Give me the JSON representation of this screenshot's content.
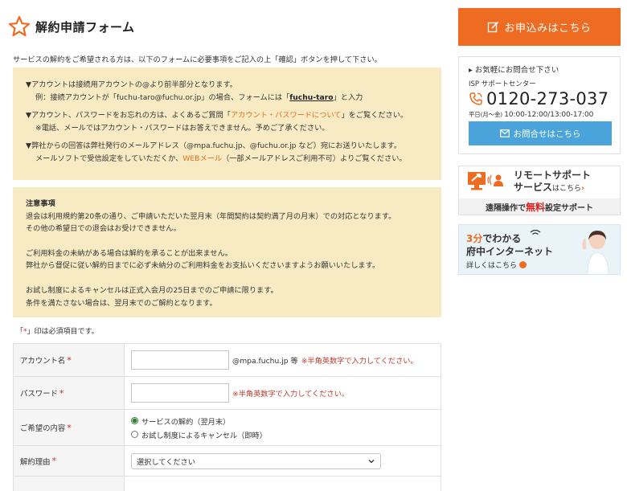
{
  "page": {
    "title": "解約申請フォーム",
    "intro": "サービスの解約をご希望される方は、以下のフォームに必要事項をご記入の上「確認」ボタンを押して下さい。"
  },
  "notice1": {
    "p1_line1": "▼アカウントは接続用アカウントの@より前半部分となります。",
    "p1_line2_a": "例：接続アカウントが「fuchu-taro@fuchu.or.jp」の場合、フォームには「",
    "p1_line2_b": "fuchu-taro",
    "p1_line2_c": "」と入力",
    "p2_line1_a": "▼アカウント、パスワードをお忘れの方は、よくあるご質問「",
    "p2_line1_b": "アカウント・パスワードについて",
    "p2_line1_c": "」をご覧ください。",
    "p2_line2": "※電話、メールではアカウント・パスワードはお答えできません。予めご了承ください。",
    "p3_line1": "▼弊社からの回答は弊社発行のメールアドレス（@mpa.fuchu.jp、@fuchu.or.jp など）宛にお送りいたします。",
    "p3_line2_a": "メールソフトで受信設定をしていただくか、",
    "p3_line2_b": "WEBメール",
    "p3_line2_c": "（一部メールアドレスご利用不可）よりご覧ください。"
  },
  "notice2": {
    "heading": "注意事項",
    "l1": "退会は利用規約第20条の通り、ご申請いただいた翌月末（年間契約は契約満了月の月末）での対応となります。",
    "l2": "その他の希望日での退会はお受けできません。",
    "l3": "ご利用料金の未納がある場合は解約を承ることが出来ません。",
    "l4": "弊社から督促に従い解約日までに必ず未納分のご利用料金をお支払いくださいますようお願いいたします。",
    "l5": "お試し制度によるキャンセルは正式入会月の25日までのご申請に限ります。",
    "l6": "条件を満たさない場合は、翌月末でのご解約となります。"
  },
  "form": {
    "required_note_a": "「",
    "required_mark": "*",
    "required_note_b": "」印は必須項目です。",
    "account_label": "アカウント名",
    "account_suffix": "@mpa.fuchu.jp 等",
    "account_hint": "※半角英数字で入力してください。",
    "password_label": "パスワード",
    "password_hint": "※半角英数字で入力してください。",
    "request_label": "ご希望の内容",
    "request_options": [
      "サービスの解約（翌月末）",
      "お試し制度によるキャンセル（即時）"
    ],
    "reason_label": "解約理由",
    "reason_selected": "選択してください"
  },
  "sidebar": {
    "apply_label": "お申込みはこちら",
    "contact_heading": "▸ お気軽にお問合せ下さい",
    "isp_label": "ISP サポートセンター",
    "phone": "0120-273-037",
    "hours_a": "平日(月〜金)",
    "hours_b": "10:00-12:00/13:00-17:00",
    "contact_button": "お問合せはこちら",
    "remote_title1": "リモートサポート",
    "remote_title2_a": "サービス",
    "remote_title2_b": "はこちら",
    "remote_arrow": "›",
    "remote_sub_a": "遠隔操作で",
    "remote_sub_b": "無料",
    "remote_sub_c": "設定サポート",
    "internet_title1_a": "3分",
    "internet_title1_b": "でわかる",
    "internet_title2": "府中インターネット",
    "internet_link": "詳しくはこちら"
  },
  "colors": {
    "accent_orange": "#ee6c22",
    "notice_bg": "#f8ebc4",
    "contact_blue": "#4aa4db",
    "required_red": "#d62b2b"
  },
  "icons": {
    "title": "star-outline-icon",
    "apply": "edit-icon",
    "phone": "phone-icon",
    "mail": "mail-icon",
    "remote": "wrench-monitor-icon",
    "select": "chevron-down-icon"
  }
}
